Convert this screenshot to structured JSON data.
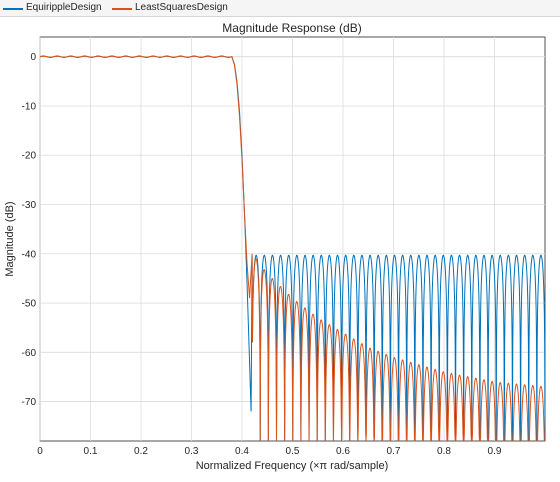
{
  "legend": {
    "items": [
      {
        "label": "EquirippleDesign",
        "color": "#0072BD"
      },
      {
        "label": "LeastSquaresDesign",
        "color": "#D95319"
      }
    ]
  },
  "chart_data": {
    "type": "line",
    "title": "Magnitude Response (dB)",
    "xlabel": "Normalized Frequency (×π rad/sample)",
    "ylabel": "Magnitude (dB)",
    "xlim": [
      0,
      1
    ],
    "ylim": [
      -78,
      4
    ],
    "xticks": [
      0,
      0.1,
      0.2,
      0.3,
      0.4,
      0.5,
      0.6,
      0.7,
      0.8,
      0.9
    ],
    "xtick_labels": [
      "0",
      "0.1",
      "0.2",
      "0.3",
      "0.4",
      "0.5",
      "0.6",
      "0.7",
      "0.8",
      "0.9"
    ],
    "yticks": [
      0,
      -10,
      -20,
      -30,
      -40,
      -50,
      -60,
      -70
    ],
    "ytick_labels": [
      "0",
      "-10",
      "-20",
      "-30",
      "-40",
      "-50",
      "-60",
      "-70"
    ],
    "grid": true,
    "series": [
      {
        "name": "EquirippleDesign",
        "color": "#0072BD",
        "passband": {
          "x_start": 0,
          "x_end": 0.38,
          "ripple_db": 0.15,
          "cycles": 14
        },
        "transition": [
          [
            0.38,
            0.0
          ],
          [
            0.385,
            -1.5
          ],
          [
            0.39,
            -5
          ],
          [
            0.395,
            -11
          ],
          [
            0.4,
            -20
          ],
          [
            0.405,
            -32
          ],
          [
            0.41,
            -46
          ],
          [
            0.415,
            -62
          ],
          [
            0.418,
            -72
          ],
          [
            0.42,
            -40.3
          ]
        ],
        "stopband": {
          "x_start": 0.42,
          "x_end": 1.0,
          "peak_db": -40.3,
          "lobes": 36,
          "null_db": -78
        }
      },
      {
        "name": "LeastSquaresDesign",
        "color": "#D95319",
        "passband": {
          "x_start": 0,
          "x_end": 0.38,
          "ripple_db": 0.08,
          "cycles": 14
        },
        "transition": [
          [
            0.38,
            0.0
          ],
          [
            0.385,
            -1.7
          ],
          [
            0.39,
            -5.5
          ],
          [
            0.395,
            -12
          ],
          [
            0.4,
            -21
          ],
          [
            0.405,
            -32
          ],
          [
            0.41,
            -42
          ],
          [
            0.415,
            -49
          ],
          [
            0.42,
            -40
          ]
        ],
        "stopband": {
          "x_start": 0.42,
          "x_end": 1.0,
          "peaks": [
            [
              0.42,
              -40
            ],
            [
              0.45,
              -44
            ],
            [
              0.5,
              -49
            ],
            [
              0.55,
              -53
            ],
            [
              0.6,
              -56
            ],
            [
              0.65,
              -59
            ],
            [
              0.7,
              -61
            ],
            [
              0.8,
              -64
            ],
            [
              0.9,
              -66
            ],
            [
              1.0,
              -67
            ]
          ],
          "lobes": 36,
          "null_db": -78
        }
      }
    ]
  }
}
